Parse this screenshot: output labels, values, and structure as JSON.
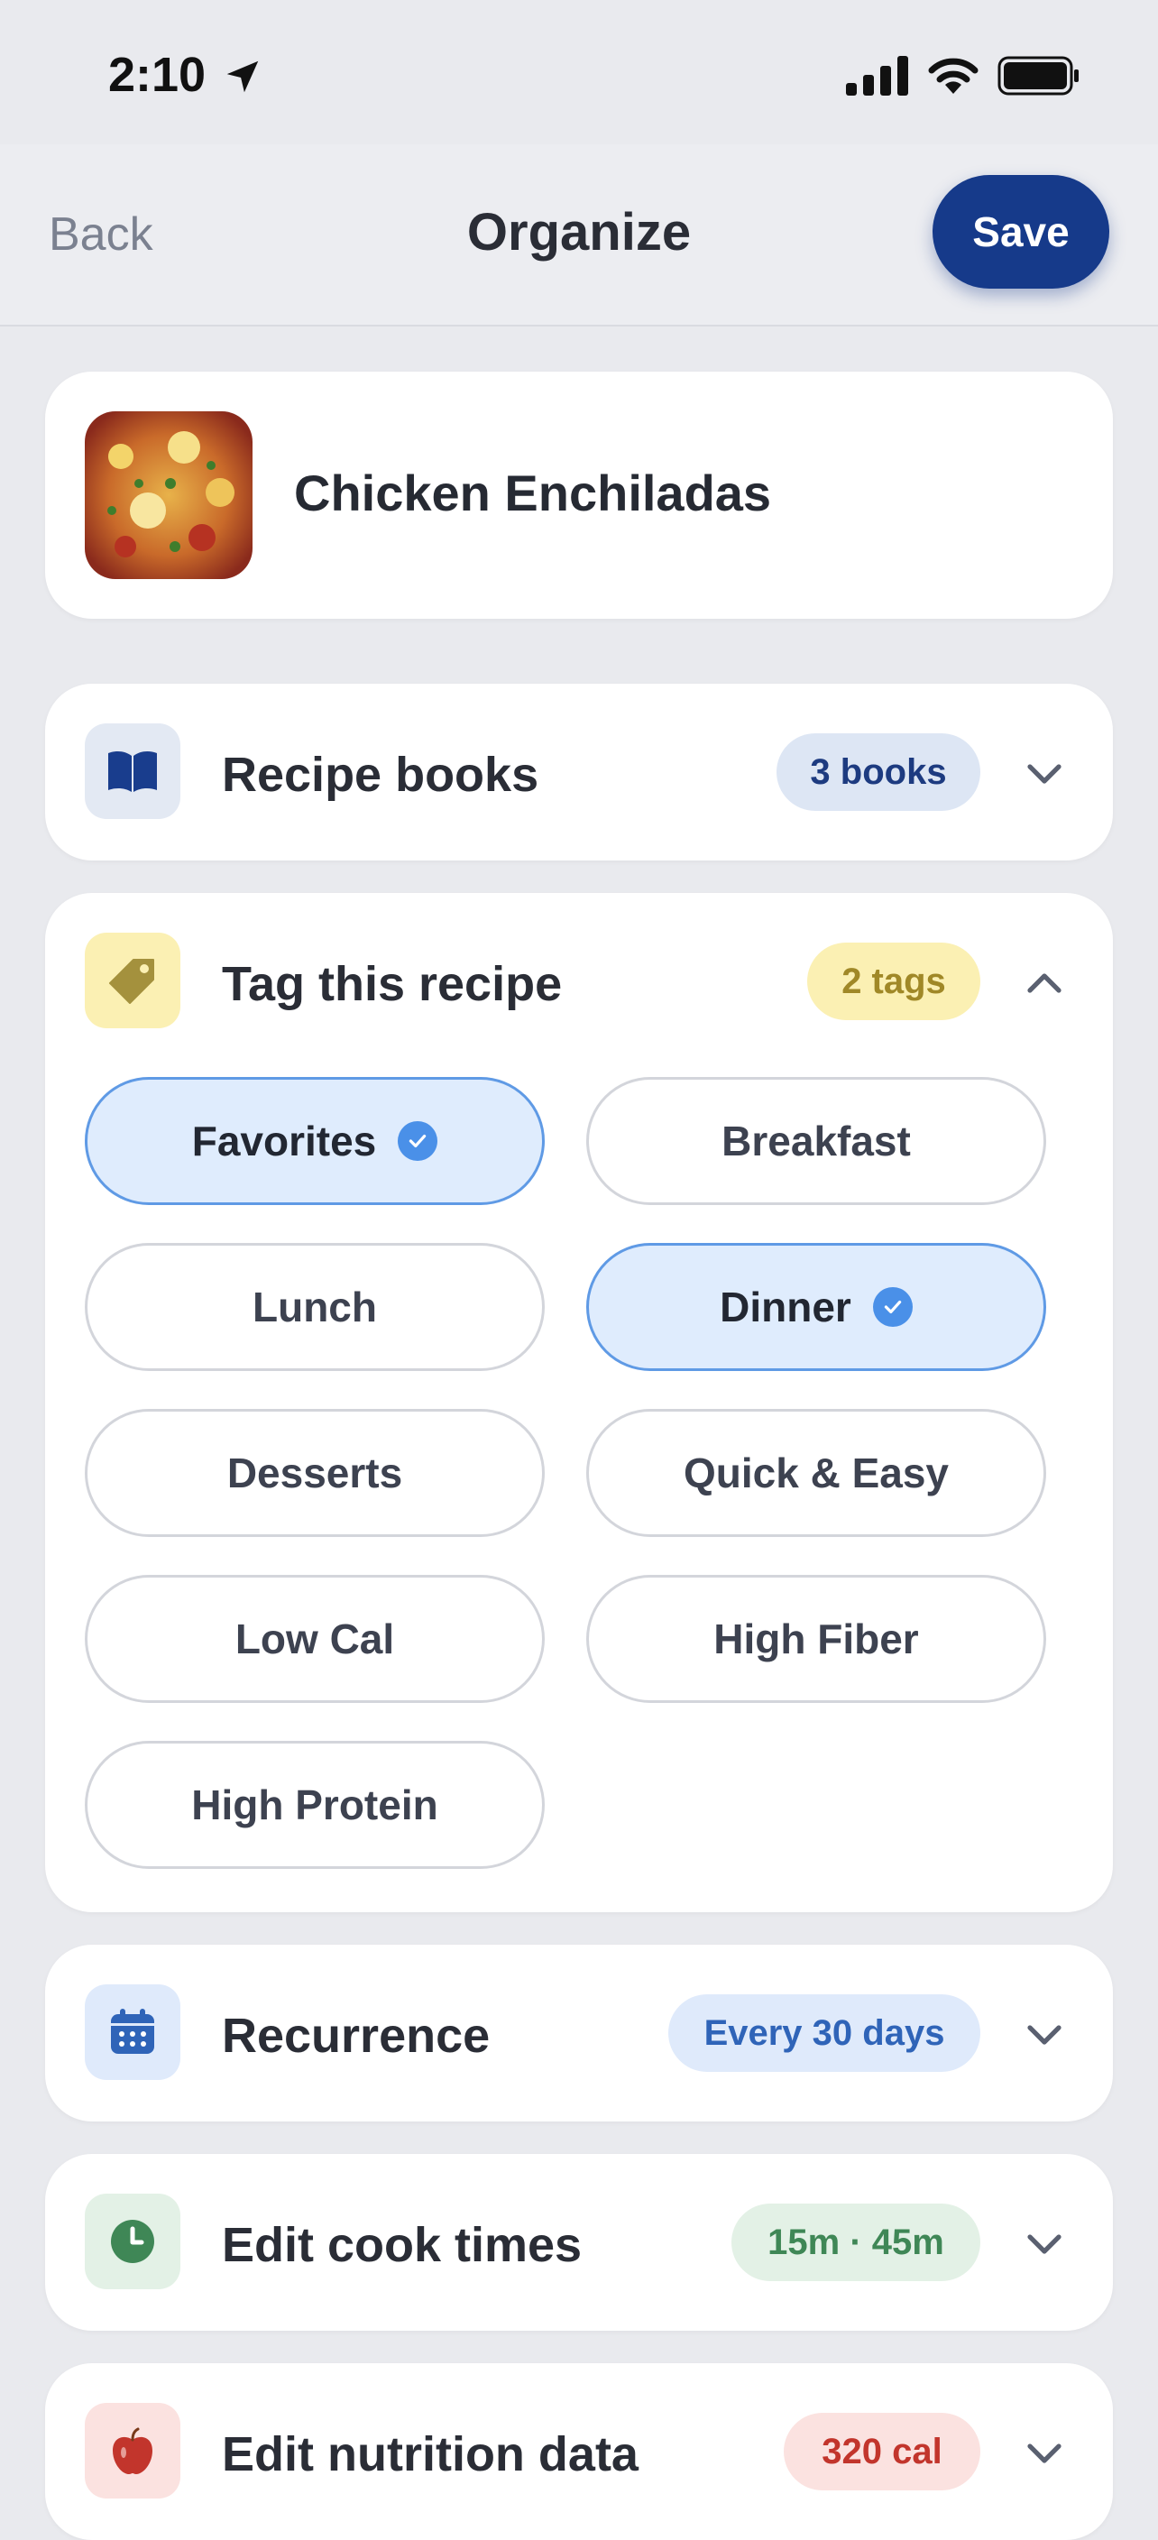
{
  "status_bar": {
    "time": "2:10"
  },
  "nav": {
    "back_label": "Back",
    "title": "Organize",
    "save_label": "Save"
  },
  "recipe": {
    "name": "Chicken Enchiladas"
  },
  "sections": {
    "books": {
      "label": "Recipe books",
      "badge": "3 books",
      "icon": "book-icon",
      "badge_bg": "#dde6f4",
      "badge_color": "#1d3b80"
    },
    "tags": {
      "label": "Tag this recipe",
      "badge": "2 tags",
      "icon": "tag-icon",
      "badge_bg": "#fbf0b3",
      "badge_color": "#a08827"
    },
    "recurrence": {
      "label": "Recurrence",
      "badge": "Every 30 days",
      "icon": "calendar-icon",
      "badge_bg": "#dfeafb",
      "badge_color": "#2f64b8"
    },
    "cook_times": {
      "label": "Edit cook times",
      "badge": "15m · 45m",
      "icon": "clock-icon",
      "badge_bg": "#e3f1e6",
      "badge_color": "#3f8756"
    },
    "nutrition": {
      "label": "Edit nutrition data",
      "badge": "320 cal",
      "icon": "apple-icon",
      "badge_bg": "#fbe2e0",
      "badge_color": "#c2352c"
    }
  },
  "tags": [
    {
      "label": "Favorites",
      "selected": true
    },
    {
      "label": "Breakfast",
      "selected": false
    },
    {
      "label": "Lunch",
      "selected": false
    },
    {
      "label": "Dinner",
      "selected": true
    },
    {
      "label": "Desserts",
      "selected": false
    },
    {
      "label": "Quick & Easy",
      "selected": false
    },
    {
      "label": "Low Cal",
      "selected": false
    },
    {
      "label": "High Fiber",
      "selected": false
    },
    {
      "label": "High Protein",
      "selected": false
    }
  ]
}
